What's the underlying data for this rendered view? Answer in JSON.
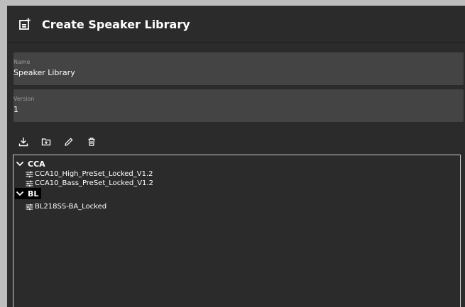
{
  "dialog": {
    "title": "Create Speaker Library",
    "title_icon": "add-box-icon"
  },
  "form": {
    "name": {
      "label": "Name",
      "value": "Speaker Library"
    },
    "version": {
      "label": "Version",
      "value": "1"
    }
  },
  "toolbar": {
    "buttons": [
      {
        "icon": "download-icon"
      },
      {
        "icon": "add-folder-icon"
      },
      {
        "icon": "edit-icon"
      },
      {
        "icon": "delete-icon"
      }
    ]
  },
  "tree": {
    "groups": [
      {
        "label": "CCA",
        "expanded": true,
        "selected": false,
        "items": [
          {
            "label": "CCA10_High_PreSet_Locked_V1.2",
            "icon": "tune-icon"
          },
          {
            "label": "CCA10_Bass_PreSet_Locked_V1.2",
            "icon": "tune-icon"
          }
        ]
      },
      {
        "label": "BL",
        "expanded": true,
        "selected": true,
        "items": [
          {
            "label": "BL218SS-BA_Locked",
            "icon": "tune-icon"
          }
        ]
      }
    ]
  },
  "colors": {
    "background": "#2b2b2b",
    "field_background": "#444444",
    "text": "#ffffff",
    "muted_text": "#9a9a9a",
    "selection": "#000000"
  }
}
